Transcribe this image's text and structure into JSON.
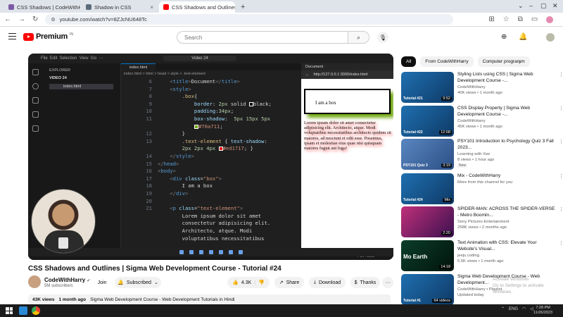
{
  "browser": {
    "tabs": [
      {
        "label": "CSS Shadows | CodeWithHarry",
        "fav_color": "#7b5aa6",
        "active": false
      },
      {
        "label": "Shadow in CSS",
        "fav_color": "#5b6b7a",
        "active": false
      },
      {
        "label": "CSS Shadows and Outlines",
        "fav_color": "#ff0000",
        "active": true
      }
    ],
    "url": "youtube.com/watch?v=8ZJcNU648Tc"
  },
  "youtube": {
    "logo_text": "Premium",
    "logo_sup": "IN",
    "search_placeholder": "Search",
    "chips": [
      "All",
      "From CodeWithHarry",
      "Computer programm"
    ],
    "video": {
      "title": "CSS Shadows and Outlines | Sigma Web Development Course - Tutorial #24",
      "channel": "CodeWithHarry",
      "subscribers": "5M subscribers",
      "join_label": "Join",
      "subscribed_label": "Subscribed",
      "likes": "4.3K",
      "share_label": "Share",
      "download_label": "Download",
      "thanks_label": "Thanks",
      "views": "43K views",
      "age": "1 month ago",
      "description": "Sigma Web Development Course - Web Development Tutorials in Hindi"
    },
    "recommendations": [
      {
        "title": "Styling Lists using CSS | Sigma Web Development Course -...",
        "channel": "CodeWithHarry",
        "meta": "40K views • 1 month ago",
        "duration": "9:52",
        "thumb_label": "Tutorial #21",
        "thumb_color": "#1f6fb0"
      },
      {
        "title": "CSS Display Property | Sigma Web Development Course -...",
        "channel": "CodeWithHarry",
        "meta": "45K views • 1 month ago",
        "duration": "12:08",
        "thumb_label": "Tutorial #22",
        "thumb_color": "#1f6fb0"
      },
      {
        "title": "PSY101 Introduction to Psychology Quiz 3 Fall 2023...",
        "channel": "Learning with Xee",
        "meta": "8 views • 1 hour ago",
        "duration": "3:19",
        "thumb_label": "PSY101 Quiz 3",
        "thumb_color": "#3b6fa8",
        "badge": "New"
      },
      {
        "title": "Mix - CodeWithHarry",
        "channel": "More from this channel for you",
        "meta": "",
        "duration": "Mix",
        "thumb_label": "Tutorial #24",
        "thumb_color": "#1f6fb0"
      },
      {
        "title": "SPIDER-MAN: ACROSS THE SPIDER-VERSE - Metro Boomin...",
        "channel": "Sony Pictures Entertainment",
        "meta": "258K views • 2 months ago",
        "duration": "2:20",
        "thumb_label": "",
        "thumb_color": "#7a2a6a"
      },
      {
        "title": "Text Animation with CSS: Elevate Your Website's Visual...",
        "channel": "jeeju.coding",
        "meta": "5.5K views • 1 month ago",
        "duration": "14:18",
        "thumb_label": "Mo  Earth",
        "thumb_color": "#0b3d2a"
      },
      {
        "title": "Sigma Web Development Course - Web Development...",
        "channel": "CodeWithHarry • Playlist",
        "meta": "Updated today",
        "duration": "64 videos",
        "thumb_label": "Tutorial #1",
        "thumb_color": "#1f6fb0"
      }
    ],
    "watermark": [
      "Activate Windows",
      "Go to Settings to activate Windows."
    ]
  },
  "vscode": {
    "title": "Video 24",
    "explorer_label": "EXPLORER",
    "folder": "VIDEO 24",
    "file": "index.html",
    "tab": "index.html",
    "breadcrumb": "index.html > html > head > style > .text-element",
    "browser_tab": "Document",
    "browser_url": "http://127.0.0.1:3000/index.html",
    "box_text": "I am a box",
    "lorem": "Lorem ipsum dolor sit amet consectetur adipisicing elit. Architecto, atque. Modi voluptatibus necessitatibus architecto quidem sit maiores, ad nesciunt et odit esse. Possimus, ipsam et molestiae eius quae nisi quisquam maiores fugiat aut fuga!",
    "status": "Port : 3000",
    "line_numbers": [
      "6",
      "7",
      "8",
      "9",
      "10",
      "11",
      "",
      "12",
      "13",
      "",
      "14",
      "15",
      "16",
      "17",
      "18",
      "19",
      "20",
      "21",
      "",
      "",
      ""
    ]
  },
  "taskbar": {
    "lang": "ENG",
    "time": "7:28 PM",
    "date": "11/26/2023"
  }
}
